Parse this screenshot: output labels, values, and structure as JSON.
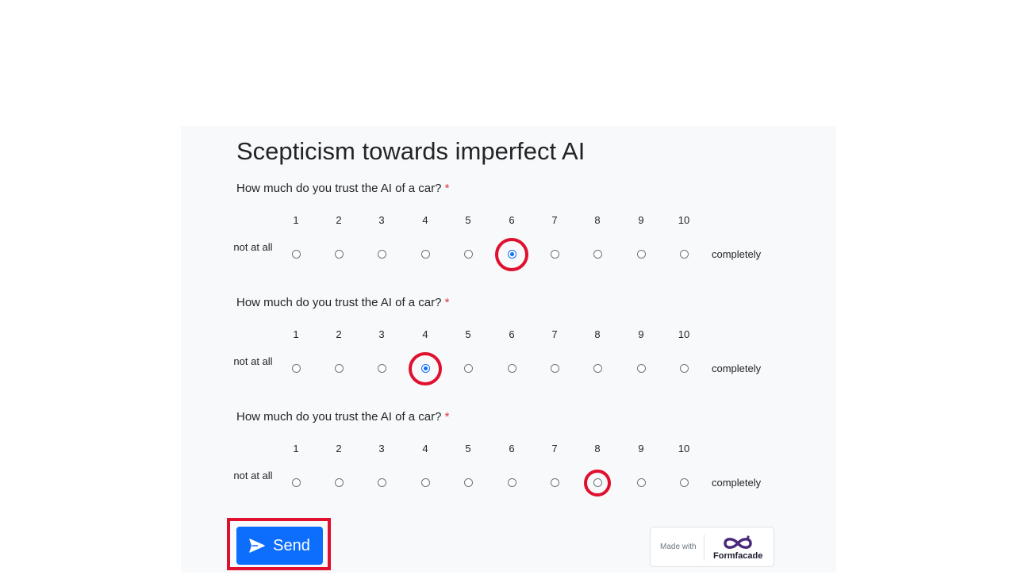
{
  "form": {
    "title": "Scepticism towards imperfect AI",
    "required_marker": "*"
  },
  "questions": [
    {
      "label": "How much do you trust the AI of a car?",
      "low_label": "not at all",
      "high_label": "completely",
      "scale": [
        "1",
        "2",
        "3",
        "4",
        "5",
        "6",
        "7",
        "8",
        "9",
        "10"
      ],
      "selected": "6",
      "highlighted": "6"
    },
    {
      "label": "How much do you trust the AI of a car?",
      "low_label": "not at all",
      "high_label": "completely",
      "scale": [
        "1",
        "2",
        "3",
        "4",
        "5",
        "6",
        "7",
        "8",
        "9",
        "10"
      ],
      "selected": "4",
      "highlighted": "4"
    },
    {
      "label": "How much do you trust the AI of a car?",
      "low_label": "not at all",
      "high_label": "completely",
      "scale": [
        "1",
        "2",
        "3",
        "4",
        "5",
        "6",
        "7",
        "8",
        "9",
        "10"
      ],
      "selected": null,
      "highlighted": "8"
    }
  ],
  "send_button": {
    "label": "Send",
    "icon": "send-icon"
  },
  "branding": {
    "made_with": "Made with",
    "name": "Formfacade",
    "logo_color": "#4b2a7a"
  },
  "colors": {
    "accent": "#0d6efd",
    "highlight": "#e0102f",
    "required": "#dc3545",
    "panel_background": "#f8f9fa"
  }
}
